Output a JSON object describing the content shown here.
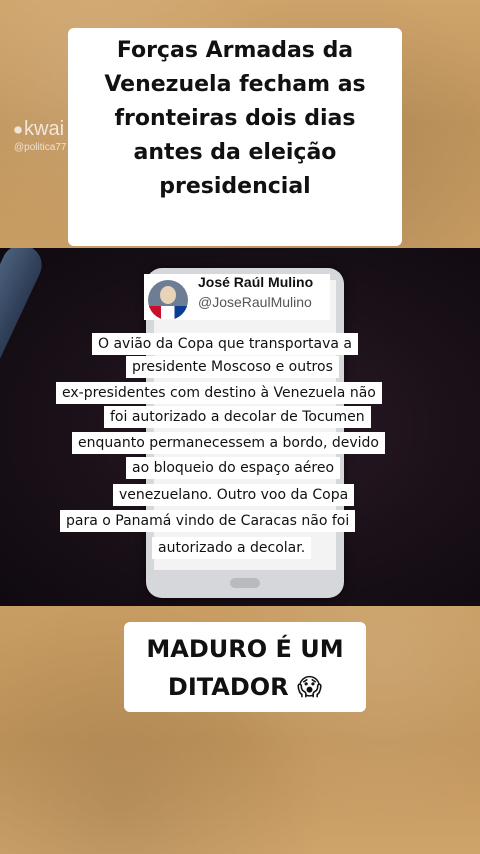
{
  "headline": {
    "lines": [
      "Forças Armadas da",
      "Venezuela fecham as",
      "fronteiras dois dias",
      "antes da eleição",
      "presidencial"
    ]
  },
  "watermark": {
    "brand": "kwai",
    "handle": "@politica77"
  },
  "tweet": {
    "name": "José Raúl Mulino",
    "handle": "@JoseRaulMulino"
  },
  "caption": {
    "lines": [
      "O avião da Copa que transportava a",
      "presidente Moscoso e outros",
      "ex-presidentes com destino à Venezuela não",
      "foi autorizado a decolar de Tocumen",
      "enquanto permanecessem a bordo, devido",
      "ao bloqueio do espaço aéreo",
      "venezuelano. Outro voo da Copa",
      "para o Panamá vindo de Caracas não foi",
      "autorizado a decolar."
    ]
  },
  "comment": {
    "line1": "MADURO É UM",
    "line2": "DITADOR",
    "emoji": "😱"
  }
}
